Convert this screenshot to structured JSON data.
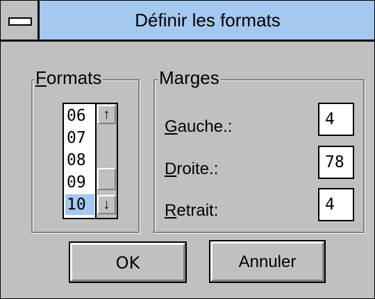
{
  "window": {
    "title": "Définir les formats"
  },
  "formats": {
    "group_label_accel": "F",
    "group_label_rest": "ormats",
    "items": [
      "06",
      "07",
      "08",
      "09",
      "10"
    ],
    "selected": "10"
  },
  "marges": {
    "group_label": "Marges",
    "gauche": {
      "label_accel": "G",
      "label_rest": "auche.:",
      "value": "4"
    },
    "droite": {
      "label_accel": "D",
      "label_rest": "roite.:",
      "value": "78"
    },
    "retrait": {
      "label_accel": "R",
      "label_rest": "etrait:",
      "value": "4"
    }
  },
  "buttons": {
    "ok": "OK",
    "annuler": "Annuler"
  },
  "icons": {
    "scroll_up": "↑",
    "scroll_down": "↓"
  }
}
